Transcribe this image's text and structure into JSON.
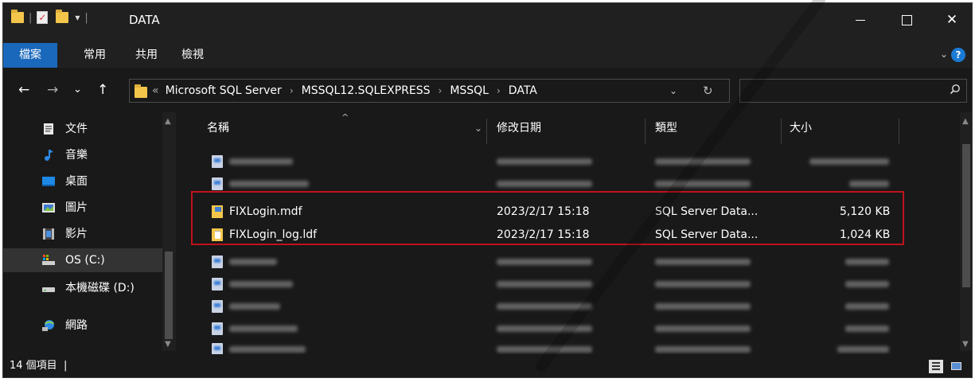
{
  "window": {
    "title": "DATA",
    "minimize_icon": "minimize-icon",
    "maximize_icon": "maximize-icon",
    "close_glyph": "✕"
  },
  "quick_access": {
    "separator": "|",
    "dropdown_glyph": "▾"
  },
  "ribbon": {
    "tabs": [
      "檔案",
      "常用",
      "共用",
      "檢視"
    ],
    "expand_glyph": "⌄",
    "help_glyph": "?"
  },
  "nav_buttons": {
    "back": "←",
    "forward": "→",
    "recent": "⌄",
    "up": "↑"
  },
  "address": {
    "overflow": "«",
    "crumbs": [
      "Microsoft SQL Server",
      "MSSQL12.SQLEXPRESS",
      "MSSQL",
      "DATA"
    ],
    "separator": "›",
    "dropdown_glyph": "⌄",
    "refresh_glyph": "↻"
  },
  "search": {
    "placeholder": "",
    "icon": "search-icon"
  },
  "nav_pane": {
    "items": [
      {
        "label": "文件",
        "icon": "documents-icon"
      },
      {
        "label": "音樂",
        "icon": "music-icon"
      },
      {
        "label": "桌面",
        "icon": "desktop-icon"
      },
      {
        "label": "圖片",
        "icon": "pictures-icon"
      },
      {
        "label": "影片",
        "icon": "videos-icon"
      },
      {
        "label": "OS (C:)",
        "icon": "drive-c-icon",
        "selected": true
      },
      {
        "label": "本機磁碟 (D:)",
        "icon": "drive-d-icon"
      },
      {
        "label": "網路",
        "icon": "network-icon"
      }
    ]
  },
  "columns": [
    "名稱",
    "修改日期",
    "類型",
    "大小"
  ],
  "sort_glyph": "^",
  "header_dropdown_glyph": "⌄",
  "files": [
    {
      "name": "FIXLogin.mdf",
      "modified": "2023/2/17 15:18",
      "type": "SQL Server Data...",
      "size": "5,120 KB",
      "icon": "sql-database-file-icon"
    },
    {
      "name": "FIXLogin_log.ldf",
      "modified": "2023/2/17 15:18",
      "type": "SQL Server Data...",
      "size": "1,024 KB",
      "icon": "sql-log-file-icon"
    }
  ],
  "status": {
    "item_count": "14 個項目",
    "cursor": "|"
  },
  "colors": {
    "accent": "#1a68bb",
    "highlight_border": "#c0121b",
    "background": "#191919"
  }
}
